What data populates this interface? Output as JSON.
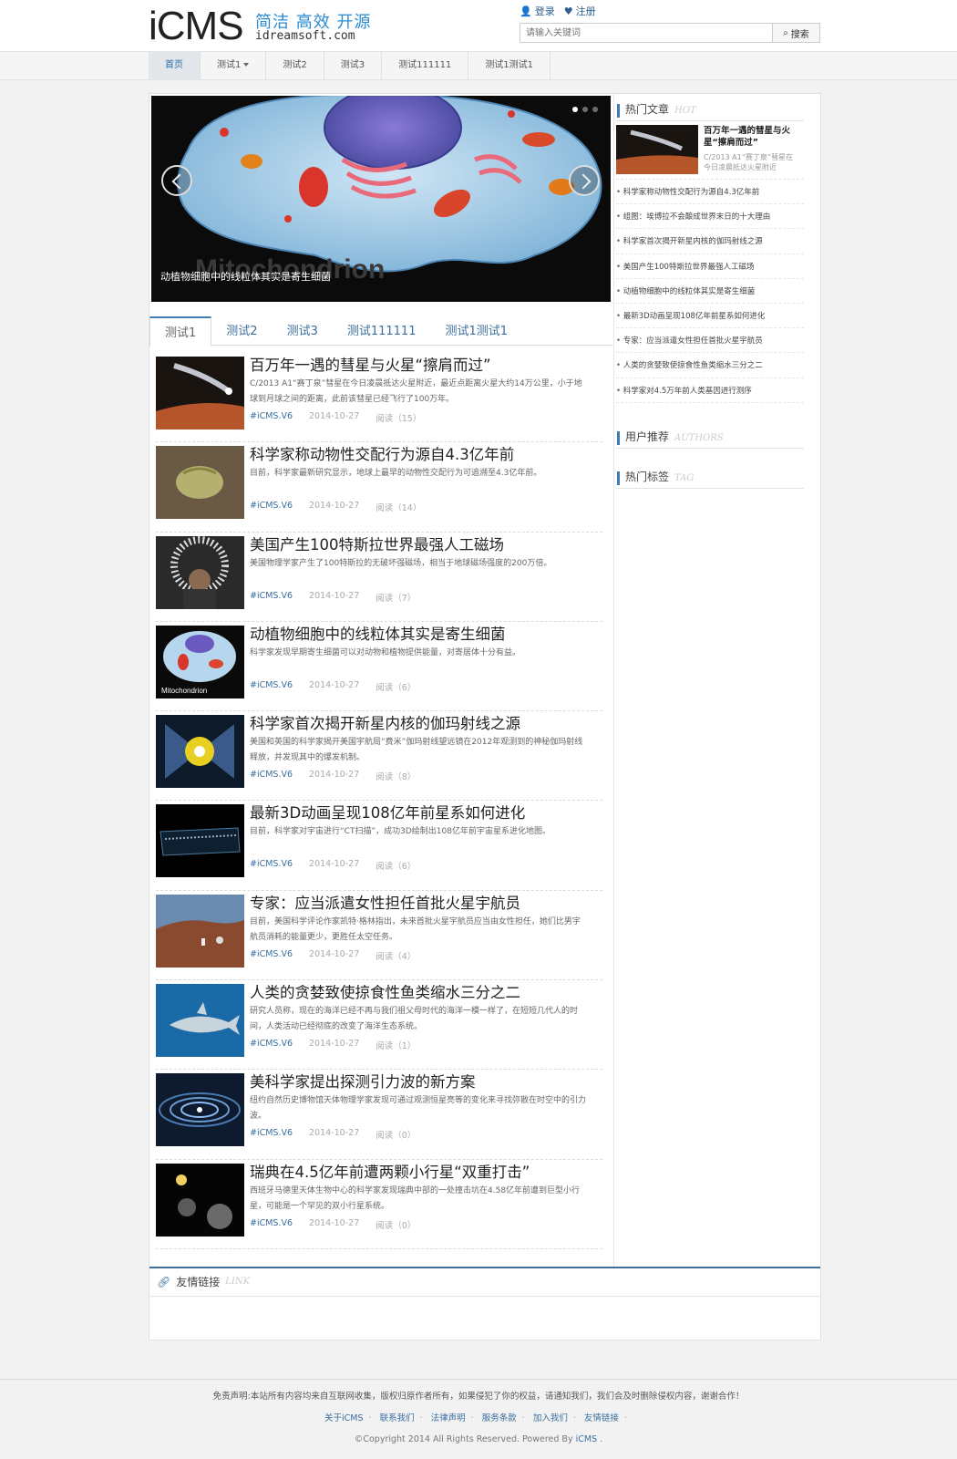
{
  "header": {
    "logo_main": "iCMS",
    "logo_slogan": "简洁 高效 开源",
    "logo_domain": "idreamsoft.com",
    "login": "登录",
    "register": "注册",
    "search_placeholder": "请输入关键词",
    "search_button": "搜索"
  },
  "nav": [
    {
      "label": "首页",
      "active": true
    },
    {
      "label": "测试1",
      "dropdown": true
    },
    {
      "label": "测试2"
    },
    {
      "label": "测试3"
    },
    {
      "label": "测试111111"
    },
    {
      "label": "测试1测试1"
    }
  ],
  "slider": {
    "caption": "动植物细胞中的线粒体其实是寄生细菌",
    "image_text": "Mitochondrion"
  },
  "tabs": [
    "测试1",
    "测试2",
    "测试3",
    "测试111111",
    "测试1测试1"
  ],
  "articles": [
    {
      "title": "百万年一遇的彗星与火星“擦肩而过”",
      "desc": "C/2013 A1“赛丁泉”彗星在今日凌晨抵达火星附近，最近点距离火星大约14万公里，小于地球到月球之间的距离，此前该彗星已经飞行了100万年。",
      "tag": "#iCMS.V6",
      "date": "2014-10-27",
      "reads": "阅读（15）"
    },
    {
      "title": "科学家称动物性交配行为源自4.3亿年前",
      "desc": "目前，科学家最新研究显示，地球上最早的动物性交配行为可追溯至4.3亿年前。",
      "tag": "#iCMS.V6",
      "date": "2014-10-27",
      "reads": "阅读（14）"
    },
    {
      "title": "美国产生100特斯拉世界最强人工磁场",
      "desc": "美国物理学家产生了100特斯拉的无破坏强磁场，相当于地球磁场强度的200万倍。",
      "tag": "#iCMS.V6",
      "date": "2014-10-27",
      "reads": "阅读（7）"
    },
    {
      "title": "动植物细胞中的线粒体其实是寄生细菌",
      "desc": "科学家发现早期寄生细菌可以对动物和植物提供能量，对寄居体十分有益。",
      "tag": "#iCMS.V6",
      "date": "2014-10-27",
      "reads": "阅读（6）"
    },
    {
      "title": "科学家首次揭开新星内核的伽玛射线之源",
      "desc": "美国和英国的科学家揭开美国宇航局“费米”伽玛射线望远镜在2012年观测到的神秘伽玛射线释放，并发现其中的爆发机制。",
      "tag": "#iCMS.V6",
      "date": "2014-10-27",
      "reads": "阅读（8）"
    },
    {
      "title": "最新3D动画呈现108亿年前星系如何进化",
      "desc": "目前，科学家对宇宙进行“CT扫描”，成功3D绘制出108亿年前宇宙星系进化地图。",
      "tag": "#iCMS.V6",
      "date": "2014-10-27",
      "reads": "阅读（6）"
    },
    {
      "title": "专家：应当派遣女性担任首批火星宇航员",
      "desc": "目前，美国科学评论作家凯特·格林指出，未来首批火星宇航员应当由女性担任，她们比男宇航员消耗的能量更少，更胜任太空任务。",
      "tag": "#iCMS.V6",
      "date": "2014-10-27",
      "reads": "阅读（4）"
    },
    {
      "title": "人类的贪婪致使掠食性鱼类缩水三分之二",
      "desc": "研究人员称，现在的海洋已经不再与我们祖父母时代的海洋一模一样了，在短短几代人的时间，人类活动已经彻底的改变了海洋生态系统。",
      "tag": "#iCMS.V6",
      "date": "2014-10-27",
      "reads": "阅读（1）"
    },
    {
      "title": "美科学家提出探测引力波的新方案",
      "desc": "纽约自然历史博物馆天体物理学家发现可通过观测恒星亮等的变化来寻找弥散在时空中的引力波。",
      "tag": "#iCMS.V6",
      "date": "2014-10-27",
      "reads": "阅读（0）"
    },
    {
      "title": "瑞典在4.5亿年前遭两颗小行星“双重打击”",
      "desc": "西班牙马德里天体生物中心的科学家发现瑞典中部的一处撞击坑在4.58亿年前遭到巨型小行星，可能是一个罕见的双小行星系统。",
      "tag": "#iCMS.V6",
      "date": "2014-10-27",
      "reads": "阅读（0）"
    }
  ],
  "sidebar": {
    "hot_title": "热门文章",
    "hot_title_en": "HOT",
    "hot_feature": {
      "title": "百万年一遇的彗星与火星“擦肩而过”",
      "desc": "C/2013 A1“赛丁泉”彗星在今日凌晨抵达火星附近"
    },
    "hot_list": [
      "科学家称动物性交配行为源自4.3亿年前",
      "组图：埃博拉不会酿成世界末日的十大理由",
      "科学家首次揭开新星内核的伽玛射线之源",
      "美国产生100特斯拉世界最强人工磁场",
      "动植物细胞中的线粒体其实是寄生细菌",
      "最新3D动画呈现108亿年前星系如何进化",
      "专家：应当派遣女性担任首批火星宇航员",
      "人类的贪婪致使掠食性鱼类缩水三分之二",
      "科学家对4.5万年前人类基因进行测序"
    ],
    "authors_title": "用户推荐",
    "authors_title_en": "AUTHORS",
    "tags_title": "热门标签",
    "tags_title_en": "TAG"
  },
  "links": {
    "title": "友情链接",
    "title_en": "LINK"
  },
  "footer": {
    "disclaimer": "免责声明:本站所有内容均来自互联网收集，版权归原作者所有，如果侵犯了你的权益，请通知我们，我们会及时删除侵权内容，谢谢合作！",
    "links": [
      "关于iCMS",
      "联系我们",
      "法律声明",
      "服务条款",
      "加入我们",
      "友情链接"
    ],
    "copyright": "©Copyright 2014 All Rights Reserved. Powered By",
    "brand": "iCMS"
  },
  "colors": {
    "accent": "#3f7bb4",
    "link": "#3a6e9e",
    "logo_slogan": "#2a8ad0"
  }
}
